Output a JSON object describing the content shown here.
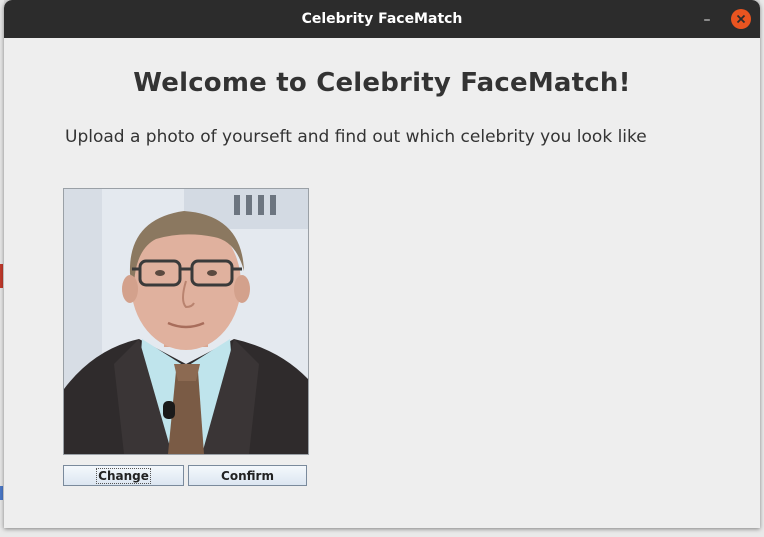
{
  "window": {
    "title": "Celebrity FaceMatch",
    "minimize_glyph": "–",
    "close_color": "#e95420"
  },
  "main": {
    "heading": "Welcome to Celebrity FaceMatch!",
    "subtitle": "Upload a photo of yourseft and find out which celebrity you look like"
  },
  "photo": {
    "icon": "person-photo"
  },
  "buttons": {
    "change_label": "Change",
    "confirm_label": "Confirm"
  }
}
